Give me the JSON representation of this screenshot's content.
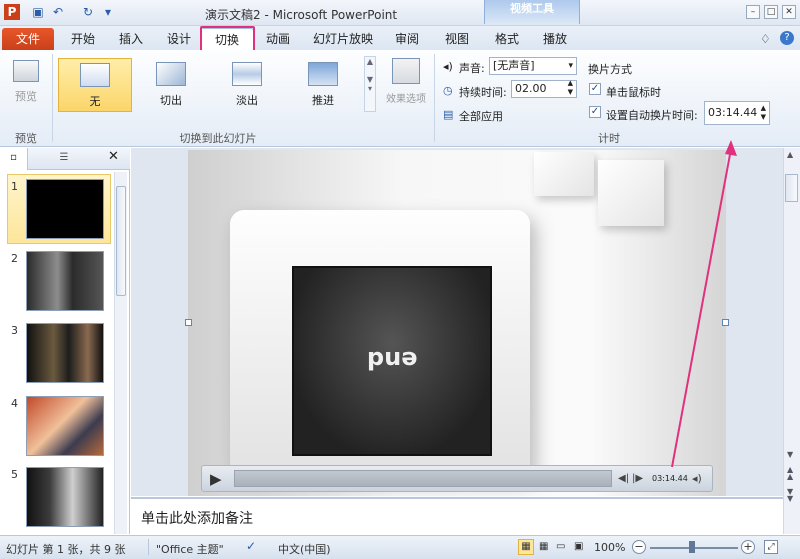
{
  "window": {
    "title": "演示文稿2 - Microsoft PowerPoint",
    "contextual_tab_group": "视频工具"
  },
  "tabs": [
    "文件",
    "开始",
    "插入",
    "设计",
    "切换",
    "动画",
    "幻灯片放映",
    "审阅",
    "视图",
    "格式",
    "播放"
  ],
  "ribbon": {
    "preview": {
      "button": "预览",
      "group": "预览"
    },
    "transitions": {
      "items": [
        "无",
        "切出",
        "淡出",
        "推进"
      ],
      "group": "切换到此幻灯片"
    },
    "effect_options": "效果选项",
    "timing": {
      "sound_label": "声音:",
      "sound_value": "[无声音]",
      "duration_label": "持续时间:",
      "duration_value": "02.00",
      "apply_all": "全部应用",
      "advance_heading": "换片方式",
      "on_click": "单击鼠标时",
      "after_time": "设置自动换片时间:",
      "after_value": "03:14.44",
      "group": "计时"
    }
  },
  "slides": [
    "1",
    "2",
    "3",
    "4",
    "5"
  ],
  "slide": {
    "text": "end",
    "time_display": "03:14.44"
  },
  "notes_placeholder": "单击此处添加备注",
  "status": {
    "slide_info": "幻灯片 第 1 张，共 9 张",
    "theme": "\"Office 主题\"",
    "language": "中文(中国)",
    "zoom": "100%"
  },
  "colors": {
    "file_tab": "#d24a21",
    "highlight": "#e0307e",
    "selected_transition": "#fbd56a"
  }
}
